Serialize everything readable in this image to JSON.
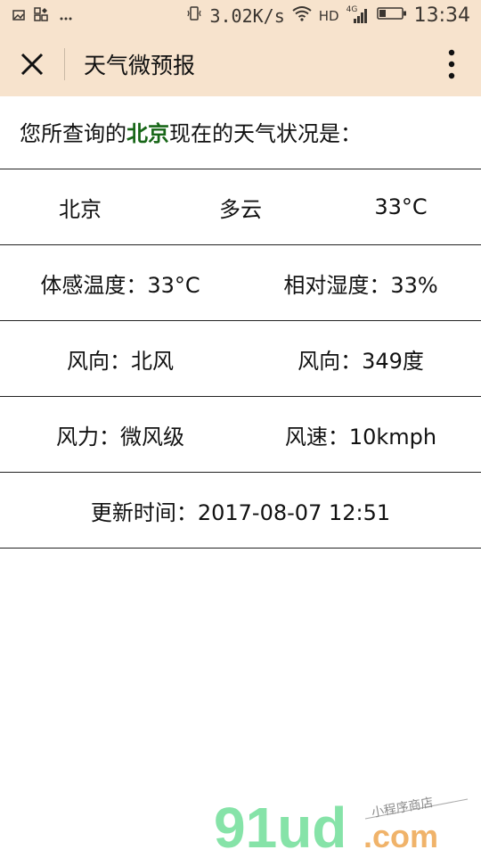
{
  "status_bar": {
    "network_speed": "3.02K/s",
    "hd_label": "HD",
    "signal_label": "4G",
    "time": "13:34"
  },
  "navbar": {
    "title": "天气微预报"
  },
  "intro": {
    "prefix": "您所查询的",
    "city": "北京",
    "suffix": "现在的天气状况是："
  },
  "weather": {
    "row1": [
      "北京",
      "多云",
      "33°C"
    ],
    "row2": [
      "体感温度：33°C",
      "相对湿度：33%"
    ],
    "row3": [
      "风向：北风",
      "风向：349度"
    ],
    "row4": [
      "风力：微风级",
      "风速：10kmph"
    ],
    "row5": [
      "更新时间：2017-08-07 12:51"
    ]
  },
  "watermark": {
    "brand": "91ud",
    "domain": ".com",
    "tagline": "小程序商店"
  },
  "colors": {
    "header_bg": "#f7e3cd",
    "city_highlight": "#176617",
    "watermark_green": "#86e3a8"
  }
}
